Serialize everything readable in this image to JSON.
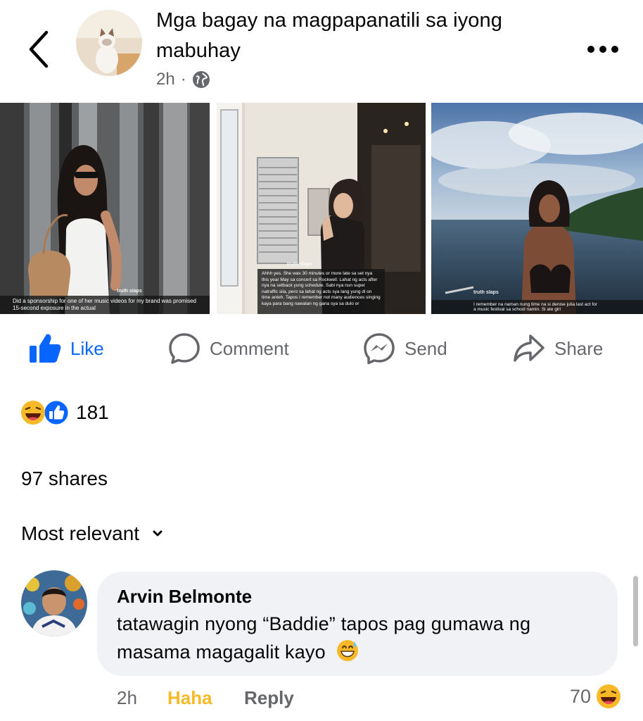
{
  "post": {
    "title": "Mga bagay na magpapanatili sa iyong mabuhay",
    "time": "2h",
    "separator": "·",
    "photos": [
      {
        "caption": "Did a sponsorship for one of her music videos for my brand was promised 15-second exposure in the actual",
        "watermark": "truth slaps"
      },
      {
        "caption": "Ahhh yes. She was 30 minutes or more late sa set nya this year May sa concert sa Rockwell. Lahat ng acts after nya na setback yung schedule. Sabi nya nun super natraffic sila, pero sa lahat ng acts sya lang yung di on time anteh. Tapos I remember not many audiences singing kaya para bang nawalan ng gana sya sa dulo or",
        "watermark": "truth slaps"
      },
      {
        "caption": "I remember na naman nung time na si denise julia last act for a music festival sa school namin. Si ate girl",
        "watermark": "truth slaps"
      }
    ]
  },
  "actions": {
    "like": "Like",
    "comment": "Comment",
    "send": "Send",
    "share": "Share"
  },
  "reactions": {
    "count": "181"
  },
  "shares": "97 shares",
  "sort": "Most relevant",
  "comment": {
    "author": "Arvin Belmonte",
    "text": "tatawagin nyong “Baddie” tapos pag gumawa ng masama magagalit kayo",
    "time": "2h",
    "haha": "Haha",
    "reply": "Reply",
    "reaction_count": "70"
  },
  "colors": {
    "accent": "#0866ff",
    "haha": "#f7b928",
    "muted": "#65676b",
    "bubble": "#f0f2f5"
  }
}
